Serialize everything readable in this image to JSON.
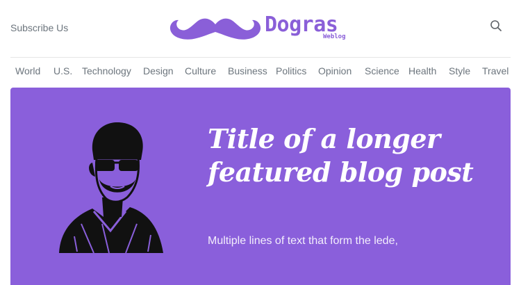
{
  "header": {
    "subscribe_label": "Subscribe Us",
    "brand_title": "Dogras",
    "brand_subtitle": "Weblog",
    "search_icon": "search-icon",
    "logo_icon": "mustache-icon"
  },
  "nav": {
    "items": [
      "World",
      "U.S.",
      "Technology",
      "Design",
      "Culture",
      "Business",
      "Politics",
      "Opinion",
      "Science",
      "Health",
      "Style",
      "Travel"
    ]
  },
  "hero": {
    "title": "Title of a longer featured blog post",
    "lede": "Multiple lines of text that form the lede,",
    "image_icon": "portrait-illustration"
  },
  "colors": {
    "accent": "#8a5fdb",
    "nav_text": "#6c757d",
    "hero_text": "#ffffff"
  }
}
